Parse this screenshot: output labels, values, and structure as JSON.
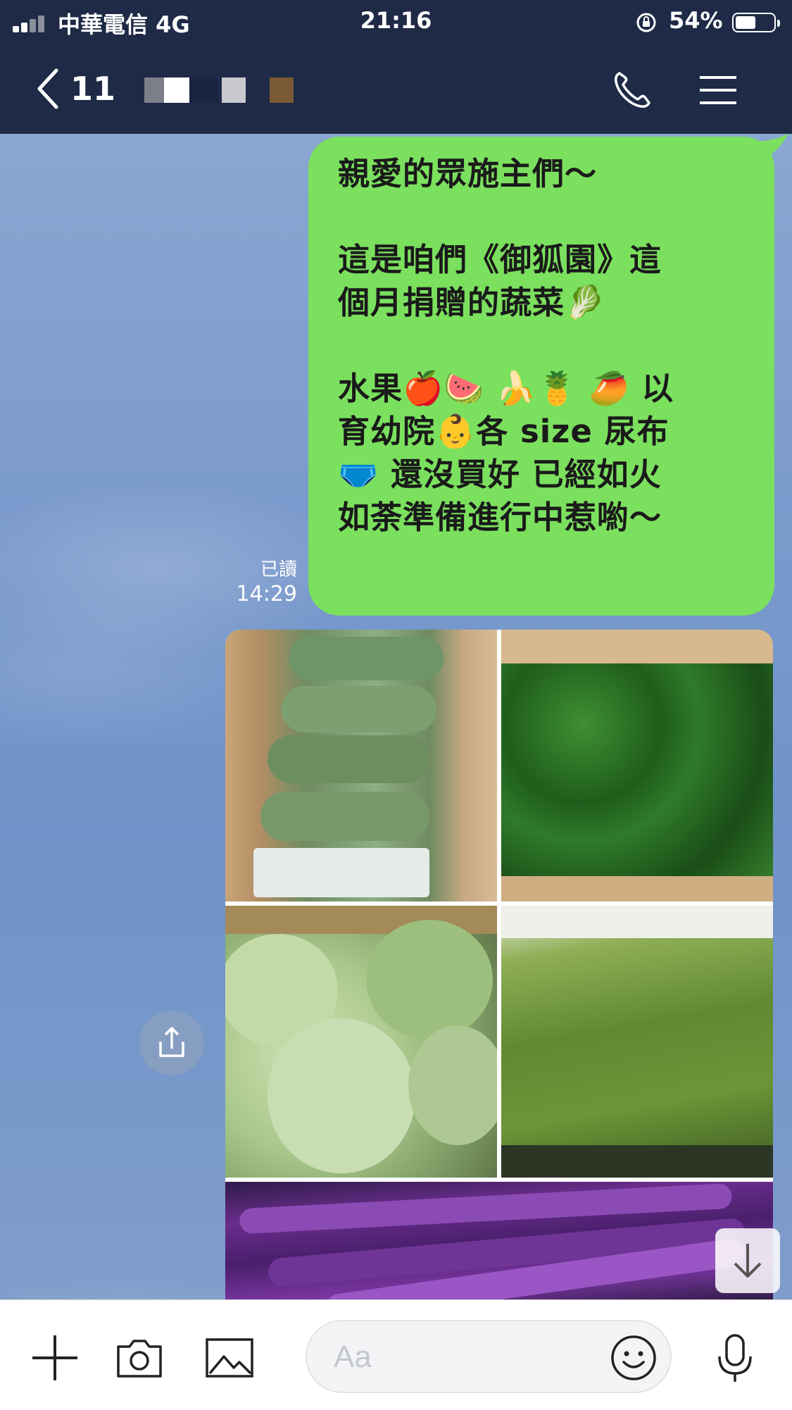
{
  "status_bar": {
    "carrier": "中華電信 4G",
    "time": "21:16",
    "battery_percent": "54%",
    "battery_level": 0.54
  },
  "header": {
    "back_count": "11",
    "icons": [
      "phone-icon",
      "menu-icon"
    ]
  },
  "message": {
    "line1": "親愛的眾施主們～",
    "line2": "這是咱們《御狐園》這",
    "line3_text": "個月捐贈的蔬菜",
    "line3_emoji": "🥬",
    "line4_text": "水果",
    "line4_emoji": "🍎🍉 🍌🍍 🥭",
    "line4_tail": " 以",
    "line5_text": "育幼院",
    "line5_emoji": "👶",
    "line5_tail": "各 size 尿布",
    "line6_emoji": "🩲",
    "line6_text": " 還沒買好 已經如火",
    "line7": "如荼準備進行中惹喲～",
    "read_label": "已讀",
    "sent_time": "14:29"
  },
  "photos": [
    "loofah",
    "green-peppers",
    "cabbage",
    "water-spinach",
    "eggplant"
  ],
  "input_bar": {
    "placeholder": "Aa",
    "icons": [
      "plus-icon",
      "camera-icon",
      "image-icon",
      "emoji-icon",
      "microphone-icon"
    ]
  },
  "colors": {
    "header_bg": "#1e2a46",
    "bubble_bg": "#7be05e",
    "chat_bg": "#7c9bcd"
  }
}
